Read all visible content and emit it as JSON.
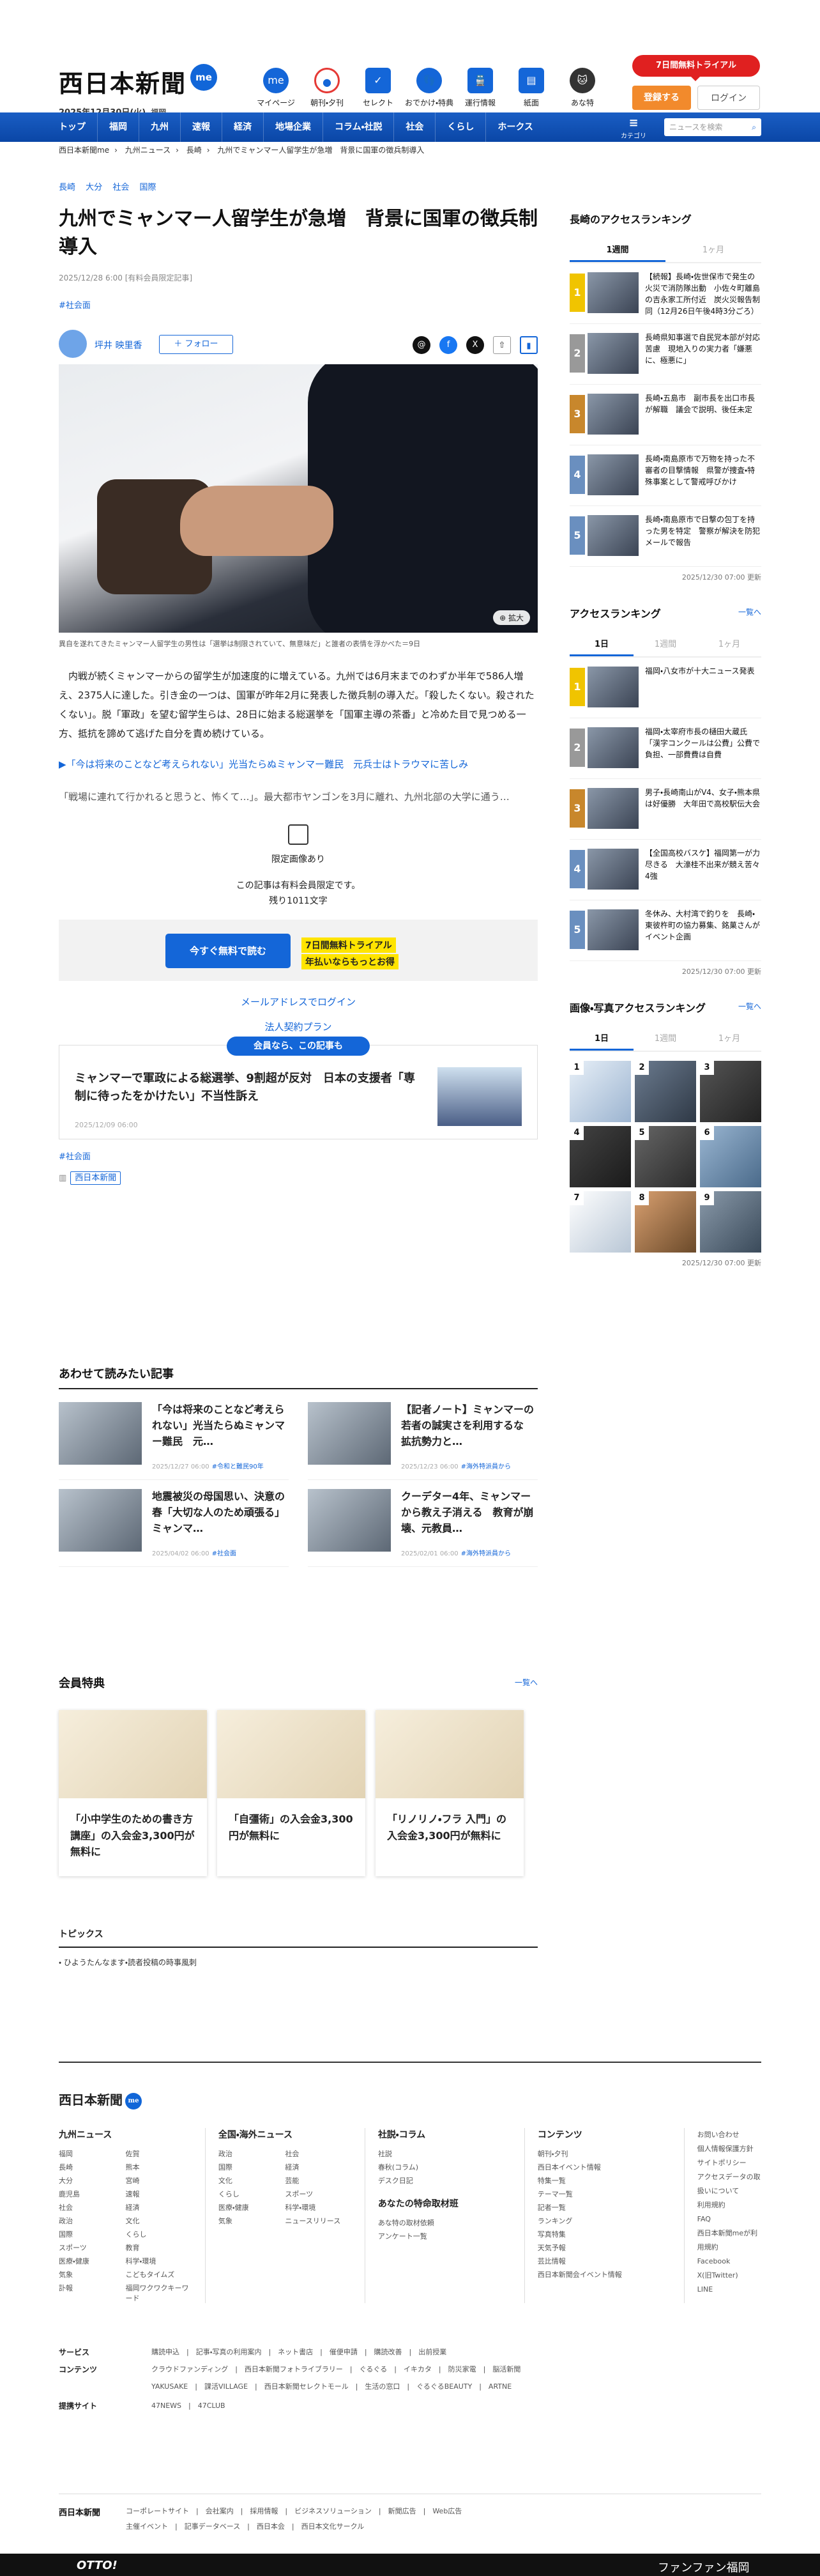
{
  "header": {
    "logo": "西日本新聞",
    "me_badge": "me",
    "date": "2025年12月30日(火)",
    "area": "福岡",
    "icons": [
      {
        "label": "マイページ",
        "icon": "me-icon"
      },
      {
        "label": "朝刊・夕刊",
        "icon": "newspaper-icon"
      },
      {
        "label": "セレクト",
        "icon": "select-icon"
      },
      {
        "label": "おでかけ・特典",
        "icon": "footprint-icon"
      },
      {
        "label": "運行情報",
        "icon": "train-icon"
      },
      {
        "label": "紙面",
        "icon": "paper-icon"
      },
      {
        "label": "あな特",
        "icon": "cat-icon"
      }
    ],
    "trial": "7日間無料トライアル",
    "register": "登録する",
    "login": "ログイン"
  },
  "nav": {
    "items": [
      "トップ",
      "福岡",
      "九州",
      "速報",
      "経済",
      "地場企業",
      "コラム・社説",
      "社会",
      "くらし",
      "ホークス"
    ],
    "menu_label": "カテゴリー一覧",
    "search_placeholder": "ニュースを検索"
  },
  "breadcrumb": [
    "西日本新聞me",
    "九州ニュース",
    "長崎",
    "九州でミャンマー人留学生が急増　背景に国軍の徴兵制導入"
  ],
  "article": {
    "tags": [
      "長崎",
      "大分",
      "社会",
      "国際"
    ],
    "title": "九州でミャンマー人留学生が急増　背景に国軍の徴兵制導入",
    "meta": "2025/12/28 6:00 [有料会員限定記事]",
    "category": "#社会面",
    "author": "坪井 映里香",
    "follow": "＋ フォロー",
    "zoom": "拡大",
    "caption": "異自を遂れてきたミャンマー人留学生の男性は「選挙は制限されていて、無意味だ」と誰者の表情を浮かべた＝9日",
    "paragraph1": "　内戦が続くミャンマーからの留学生が加速度的に増えている。九州では6月末までのわずか半年で586人増え、2375人に達した。引き金の一つは、国軍が昨年2月に発表した徴兵制の導入だ。「殺したくない。殺されたくない」。脱「軍政」を望む留学生らは、28日に始まる総選挙を「国軍主導の茶番」と冷めた目で見つめる一方、抵抗を諦めて逃げた自分を責め続けている。",
    "related_link": "▶「今は将来のことなど考えられない」光当たらぬミャンマー難民　元兵士はトラウマに苦しみ",
    "paragraph2": "「戦場に連れて行かれると思うと、怖くて…」。最大都市ヤンゴンを3月に離れ、九州北部の大学に通う…",
    "limited_image": "限定画像あり",
    "members_only": "この記事は有料会員限定です。",
    "remaining": "残り1011文字",
    "read_free": "今すぐ無料で読む",
    "trial_badge": "7日間無料トライアル",
    "annual_badge": "年払いならもっとお得",
    "mail_login": "メールアドレスでログイン",
    "corp_plan": "法人契約プラン",
    "member_pill": "会員なら、この記事も",
    "member_title": "ミャンマーで軍政による総選挙、9割超が反対　日本の支援者「専制に待ったをかけたい」不当性訴え",
    "member_date": "2025/12/09 06:00",
    "footer_tag": "#社会面",
    "source_badge": "西日本新聞"
  },
  "sidebar": {
    "access_nagasaki": {
      "heading": "長崎のアクセスランキング",
      "tabs": [
        "1週間",
        "1ヶ月"
      ],
      "items": [
        {
          "rank": "1",
          "text": "【続報】長崎・佐世保市で発生の火災で消防隊出動　小佐々町離島の吉永家工所付近　炭火災報告制同（12月26日午後4時3分ごろ）"
        },
        {
          "rank": "2",
          "text": "長崎県知事選で自民党本部が対応苦慮　現地入りの実力者「嫌悪に、極悪に」"
        },
        {
          "rank": "3",
          "text": "長崎・五島市　副市長を出口市長が解職　議会で説明、後任未定"
        },
        {
          "rank": "4",
          "text": "長崎・南島原市で万物を持った不審者の目撃情報　県警が捜査・特殊事案として警戒呼びかけ"
        },
        {
          "rank": "5",
          "text": "長崎・南島原市で日撃の包丁を持った男を特定　警察が解決を防犯メールで報告"
        }
      ],
      "updated": "2025/12/30 07:00 更新"
    },
    "access": {
      "heading": "アクセスランキング",
      "more": "一覧へ",
      "tabs": [
        "1日",
        "1週間",
        "1ヶ月"
      ],
      "items": [
        {
          "rank": "1",
          "text": "福岡・八女市が十大ニュース発表"
        },
        {
          "rank": "2",
          "text": "福岡・太宰府市長の樋田大蔵氏「漢字コンクールは公費」公費で負担、一部費費は自費"
        },
        {
          "rank": "3",
          "text": "男子・長崎南山がV4、女子・熊本県は好優勝　大年田で高校駅伝大会"
        },
        {
          "rank": "4",
          "text": "【全国高校バスケ】福岡第一が力尽きる　大濠桂不出来が競え苦々4強"
        },
        {
          "rank": "5",
          "text": "冬休み、大村湾で釣りを　長崎・東彼杵町の協力募集、銘菓さんがイベント企画"
        }
      ],
      "updated": "2025/12/30 07:00 更新"
    },
    "photo": {
      "heading": "画像・写真アクセスランキング",
      "more": "一覧へ",
      "tabs": [
        "1日",
        "1週間",
        "1ヶ月"
      ],
      "ranks": [
        "1",
        "2",
        "3",
        "4",
        "5",
        "6",
        "7",
        "8",
        "9"
      ],
      "updated": "2025/12/30 07:00 更新"
    }
  },
  "related": {
    "heading": "あわせて読みたい記事",
    "items": [
      {
        "title": "「今は将来のことなど考えられない」光当たらぬミャンマー難民　元…",
        "date": "2025/12/27 06:00",
        "tag": "#令和と難民90年"
      },
      {
        "title": "【記者ノート】ミャンマーの若者の誠実さを利用するな　拡抗勢力と…",
        "date": "2025/12/23 06:00",
        "tag": "#海外特派員から"
      },
      {
        "title": "地震被災の母国思い、決意の春「大切な人のため頑張る」ミャンマ…",
        "date": "2025/04/02 06:00",
        "tag": "#社会面"
      },
      {
        "title": "クーデター4年、ミャンマーから教え子消える　教育が崩壊、元教員…",
        "date": "2025/02/01 06:00",
        "tag": "#海外特派員から"
      }
    ]
  },
  "perks": {
    "heading": "会員特典",
    "more": "一覧へ",
    "items": [
      {
        "title": "「小中学生のための書き方講座」の入会金3,300円が無料に"
      },
      {
        "title": "「自彊術」の入会金3,300円が無料に"
      },
      {
        "title": "「リノリノ・フラ 入門」の入会金3,300円が無料に"
      }
    ]
  },
  "topics": {
    "heading": "トピックス",
    "item": "・ ひようたんなます・読者投稿の時事風刺"
  },
  "footer": {
    "logo": "西日本新聞",
    "badge": "me",
    "cols": [
      {
        "title": "九州ニュース",
        "items": [
          "福岡",
          "佐賀",
          "長崎",
          "熊本",
          "大分",
          "宮崎",
          "鹿児島",
          "速報",
          "社会",
          "経済",
          "政治",
          "文化",
          "国際",
          "くらし",
          "スポーツ",
          "教育",
          "医療・健康",
          "科学・環境",
          "気象",
          "こどもタイムズ",
          "訃報",
          "福岡ワクワクキーワード"
        ]
      },
      {
        "title": "全国・海外ニュース",
        "items": [
          "政治",
          "社会",
          "国際",
          "経済",
          "文化",
          "芸能",
          "くらし",
          "スポーツ",
          "医療・健康",
          "科学・環境",
          "気象",
          "ニュースリリース"
        ]
      },
      {
        "title": "社説・コラム",
        "items": [
          "社説",
          "春秋(コラム)",
          "デスク日記"
        ],
        "title2": "あなたの特命取材班",
        "items2": [
          "あな特の取材依頼",
          "アンケート一覧"
        ]
      },
      {
        "title": "コンテンツ",
        "items": [
          "朝刊・夕刊",
          "西日本イベント情報",
          "特集一覧",
          "テーマ一覧",
          "記者一覧",
          "ランキング",
          "写真特集",
          "天気予報",
          "芸比情報",
          "西日本新聞会イベント情報"
        ]
      }
    ],
    "col5": [
      "お問い合わせ",
      "個人情報保護方針",
      "サイトポリシー",
      "アクセスデータの取扱いについて",
      "利用規約",
      "FAQ",
      "西日本新聞meが利用規約",
      "Facebook",
      "X(旧Twitter)",
      "LINE"
    ],
    "services": [
      {
        "label": "サービス",
        "value": "購読申込　|　記事・写真の利用案内　|　ネット書店　|　催便申請　|　購読改善　|　出前授業"
      },
      {
        "label": "コンテンツ",
        "value": "クラウドファンディング　|　西日本新聞フォトライブラリー　|　ぐるぐる　|　イキカタ　|　防災家電　|　脳活新聞"
      },
      {
        "label": "",
        "value": "YAKUSAKE　|　課活VILLAGE　|　西日本新聞セレクトモール　|　生活の窓口　|　ぐるぐるBEAUTY　|　ARTNE"
      },
      {
        "label": "提携サイト",
        "value": "47NEWS　|　47CLUB"
      }
    ],
    "corp": "西日本新聞",
    "corp_links": "コーポレートサイト　|　会社案内　|　採用情報　|　ビジネスソリューション　|　新聞広告　|　Web広告",
    "corp_links2": "主催イベント　|　記事データベース　|　西日本会　|　西日本文化サークル",
    "ad_left": "OTTO!",
    "ad_right": "ファンファン福岡"
  }
}
